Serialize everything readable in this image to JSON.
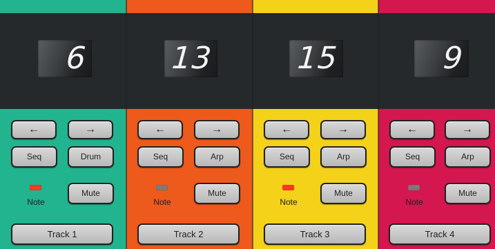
{
  "tracks": [
    {
      "color": "#22b48f",
      "number": "6",
      "left_label": "←",
      "right_label": "→",
      "seq_label": "Seq",
      "mode_label": "Drum",
      "note_label": "Note",
      "note_led": "on",
      "mute_label": "Mute",
      "track_label": "Track 1"
    },
    {
      "color": "#ee5a1c",
      "number": "13",
      "left_label": "←",
      "right_label": "→",
      "seq_label": "Seq",
      "mode_label": "Arp",
      "note_label": "Note",
      "note_led": "off",
      "mute_label": "Mute",
      "track_label": "Track 2"
    },
    {
      "color": "#f5d21a",
      "number": "15",
      "left_label": "←",
      "right_label": "→",
      "seq_label": "Seq",
      "mode_label": "Arp",
      "note_label": "Note",
      "note_led": "on",
      "mute_label": "Mute",
      "track_label": "Track 3"
    },
    {
      "color": "#d4174f",
      "number": "9",
      "left_label": "←",
      "right_label": "→",
      "seq_label": "Seq",
      "mode_label": "Arp",
      "note_label": "Note",
      "note_led": "off",
      "mute_label": "Mute",
      "track_label": "Track 4"
    }
  ],
  "led_colors": {
    "on": "#ff3a1e",
    "off": "#7b7b7b"
  }
}
